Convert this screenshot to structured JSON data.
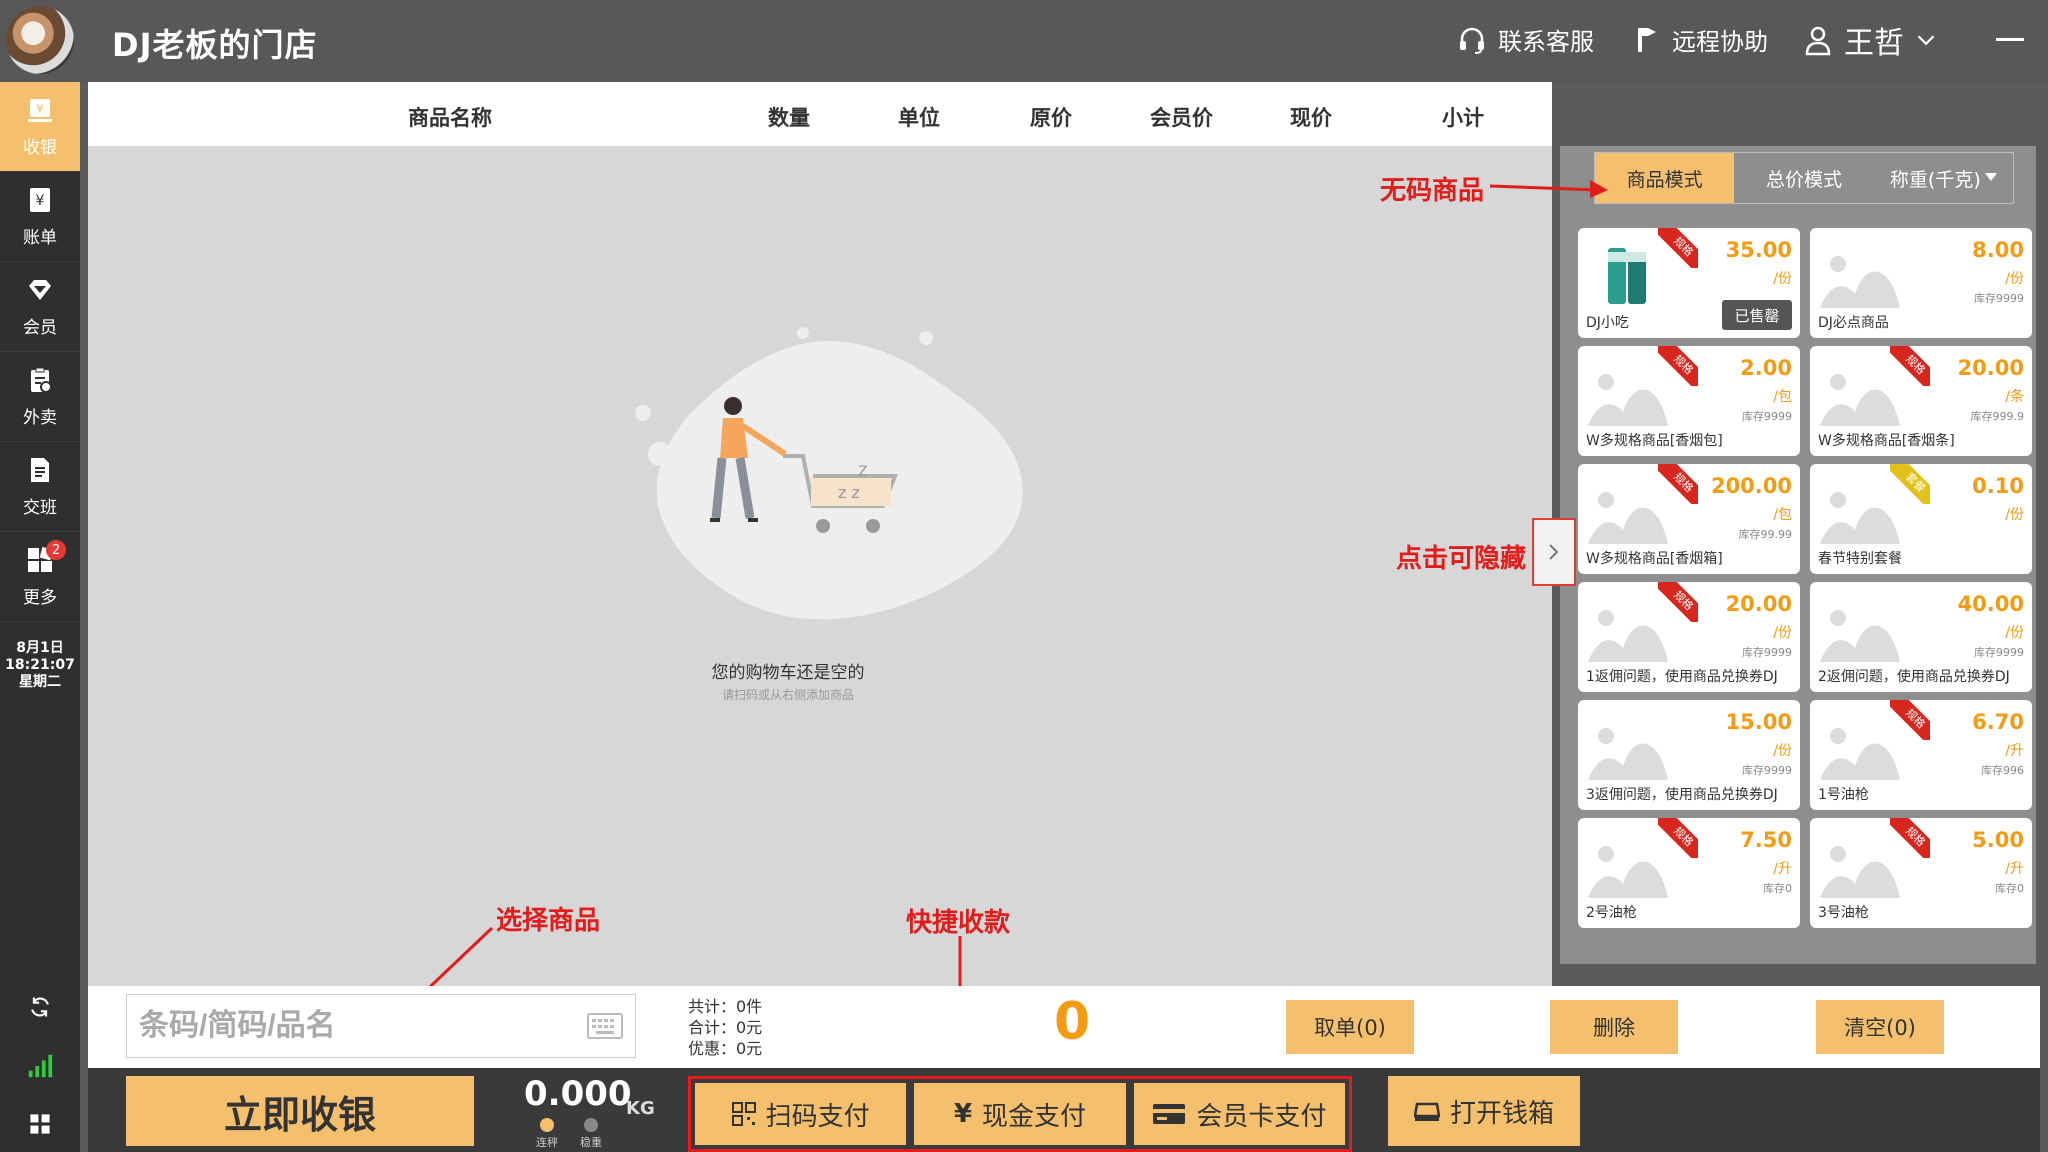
{
  "header": {
    "store_name": "DJ老板的门店",
    "support_label": "联系客服",
    "remote_label": "远程协助",
    "user_name": "王哲"
  },
  "sidebar": {
    "items": [
      {
        "label": "收银",
        "icon": "cashier-icon"
      },
      {
        "label": "账单",
        "icon": "bill-icon"
      },
      {
        "label": "会员",
        "icon": "member-icon"
      },
      {
        "label": "外卖",
        "icon": "takeout-icon"
      },
      {
        "label": "交班",
        "icon": "handover-icon"
      },
      {
        "label": "更多",
        "icon": "more-icon",
        "badge": "2"
      }
    ],
    "date": "8月1日",
    "time": "18:21:07",
    "weekday": "星期二"
  },
  "cart": {
    "columns": [
      "商品名称",
      "数量",
      "单位",
      "原价",
      "会员价",
      "现价",
      "小计"
    ],
    "empty_title": "您的购物车还是空的",
    "empty_sub": "请扫码或从右侧添加商品"
  },
  "modes": {
    "product_mode": "商品模式",
    "total_mode": "总价模式",
    "weight_mode": "称重(千克)"
  },
  "products": [
    {
      "name": "DJ小吃",
      "price": "35.00",
      "unit": "/份",
      "stock": "",
      "ribbon": "规格",
      "soldout": "已售罄"
    },
    {
      "name": "DJ必点商品",
      "price": "8.00",
      "unit": "/份",
      "stock": "库存9999",
      "ribbon": ""
    },
    {
      "name": "W多规格商品[香烟包]",
      "price": "2.00",
      "unit": "/包",
      "stock": "库存9999",
      "ribbon": "规格"
    },
    {
      "name": "W多规格商品[香烟条]",
      "price": "20.00",
      "unit": "/条",
      "stock": "库存999.9",
      "ribbon": "规格"
    },
    {
      "name": "W多规格商品[香烟箱]",
      "price": "200.00",
      "unit": "/包",
      "stock": "库存99.99",
      "ribbon": "规格"
    },
    {
      "name": "春节特别套餐",
      "price": "0.10",
      "unit": "/份",
      "stock": "",
      "ribbon": "套餐"
    },
    {
      "name": "1返佣问题，使用商品兑换券DJ",
      "price": "20.00",
      "unit": "/份",
      "stock": "库存9999",
      "ribbon": "规格"
    },
    {
      "name": "2返佣问题，使用商品兑换券DJ",
      "price": "40.00",
      "unit": "/份",
      "stock": "库存9999",
      "ribbon": ""
    },
    {
      "name": "3返佣问题，使用商品兑换券DJ",
      "price": "15.00",
      "unit": "/份",
      "stock": "库存9999",
      "ribbon": ""
    },
    {
      "name": "1号油枪",
      "price": "6.70",
      "unit": "/升",
      "stock": "库存996",
      "ribbon": "规格"
    },
    {
      "name": "2号油枪",
      "price": "7.50",
      "unit": "/升",
      "stock": "库存0",
      "ribbon": "规格"
    },
    {
      "name": "3号油枪",
      "price": "5.00",
      "unit": "/升",
      "stock": "库存0",
      "ribbon": "规格"
    }
  ],
  "annotations": {
    "no_code": "无码商品",
    "hide": "点击可隐藏",
    "select": "选择商品",
    "quick_pay": "快捷收款"
  },
  "input_bar": {
    "search_placeholder": "条码/简码/品名",
    "total_count": "共计：0件",
    "total_sum": "合计：0元",
    "discount": "优惠：0元",
    "big_total": "0",
    "take_order": "取单(0)",
    "delete": "删除",
    "clear": "清空(0)"
  },
  "pay_bar": {
    "checkout": "立即收银",
    "weight": "0.000",
    "weight_unit": "KG",
    "scale_label_1": "连秤",
    "scale_label_2": "稳重",
    "scan_pay": "扫码支付",
    "cash_pay": "现金支付",
    "card_pay": "会员卡支付",
    "open_drawer": "打开钱箱"
  },
  "colors": {
    "accent": "#f5c06d",
    "price": "#f39c12",
    "annotation": "#e21b1b",
    "sidebar_bg": "#2f2f2f"
  }
}
